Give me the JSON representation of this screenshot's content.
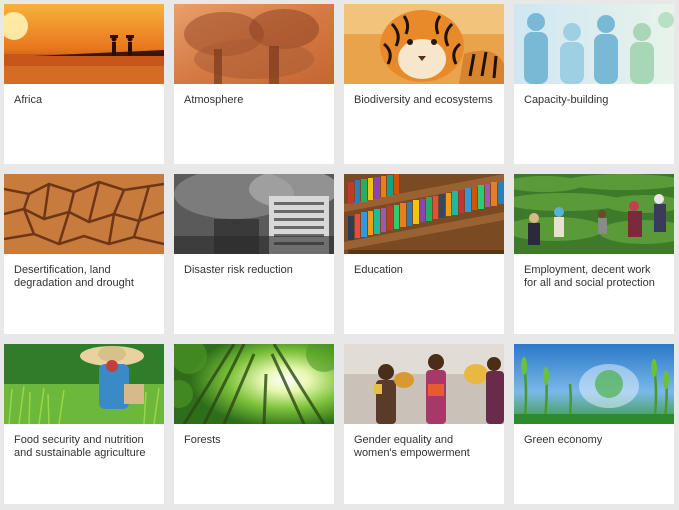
{
  "topics": [
    {
      "id": "africa",
      "label": "Africa"
    },
    {
      "id": "atmosphere",
      "label": "Atmosphere"
    },
    {
      "id": "biodiversity",
      "label": "Biodiversity and ecosystems"
    },
    {
      "id": "capacity",
      "label": "Capacity-building"
    },
    {
      "id": "desertification",
      "label": "Desertification, land degradation and drought"
    },
    {
      "id": "disaster",
      "label": "Disaster risk reduction"
    },
    {
      "id": "education",
      "label": "Education"
    },
    {
      "id": "employment",
      "label": "Employment, decent work for all and social protection"
    },
    {
      "id": "food",
      "label": "Food security and nutrition and sustainable agriculture"
    },
    {
      "id": "forests",
      "label": "Forests"
    },
    {
      "id": "gender",
      "label": "Gender equality and women's empowerment"
    },
    {
      "id": "green",
      "label": "Green economy"
    }
  ]
}
